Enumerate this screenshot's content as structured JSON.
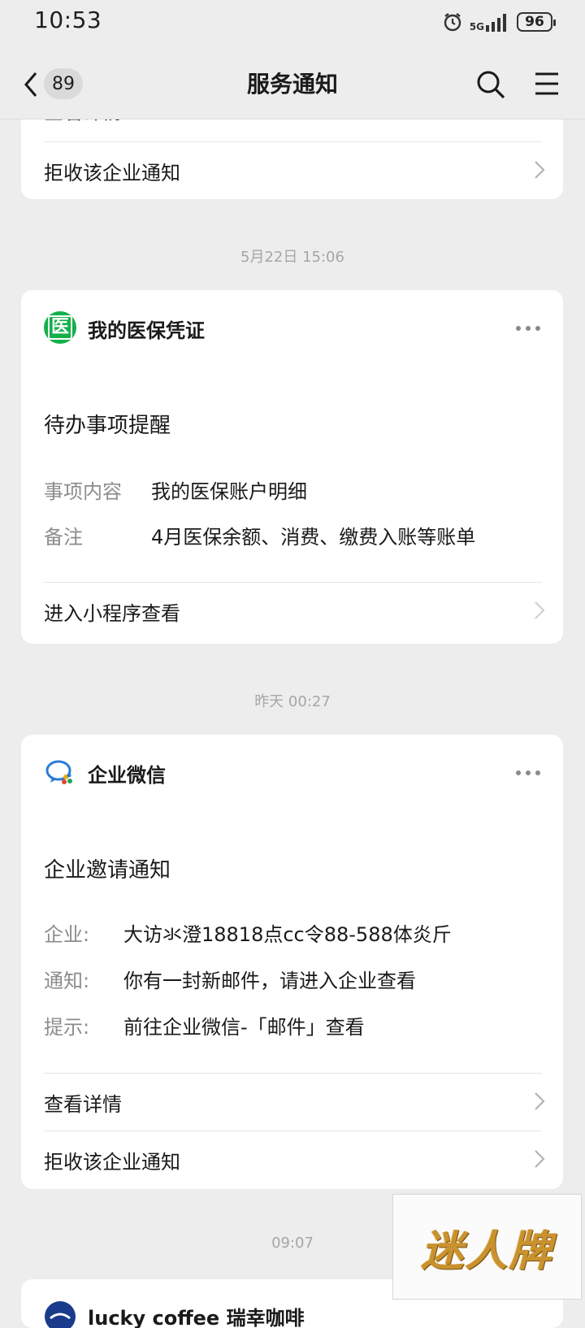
{
  "status_bar": {
    "time": "10:53",
    "network": "5G",
    "battery": "96"
  },
  "nav": {
    "badge": "89",
    "title": "服务通知"
  },
  "card0": {
    "partial_label": "查看详情",
    "reject_label": "拒收该企业通知"
  },
  "sep1": "5月22日 15:06",
  "card1": {
    "app_icon_char": "医",
    "app_name": "我的医保凭证",
    "msg_title": "待办事项提醒",
    "fields": [
      {
        "key": "事项内容",
        "value": "我的医保账户明细"
      },
      {
        "key": "备注",
        "value": "4月医保余额、消费、缴费入账等账单"
      }
    ],
    "action_label": "进入小程序查看"
  },
  "sep2": "昨天 00:27",
  "card2": {
    "app_name": "企业微信",
    "msg_title": "企业邀请通知",
    "fields": [
      {
        "key": "企业:",
        "value": "大访氺澄18818点cc令88-588体炎斤"
      },
      {
        "key": "通知:",
        "value": "你有一封新邮件，请进入企业查看"
      },
      {
        "key": "提示:",
        "value": "前往企业微信-「邮件」查看"
      }
    ],
    "detail_label": "查看详情",
    "reject_label": "拒收该企业通知"
  },
  "sep3": "09:07",
  "card3": {
    "partial_name": "lucky coffee 瑞幸咖啡"
  },
  "watermark": "迷人牌",
  "colors": {
    "background": "#ededed",
    "card": "#ffffff",
    "medical_green": "#14b04a",
    "wecom_blue": "#2b7bd8"
  }
}
